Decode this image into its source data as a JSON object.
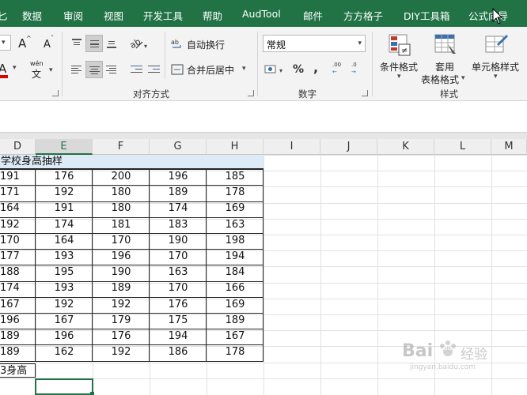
{
  "menubar": {
    "tabs": [
      "匕",
      "数据",
      "审阅",
      "视图",
      "开发工具",
      "帮助",
      "AudTool",
      "邮件",
      "方方格子",
      "DIY工具箱",
      "公式向导"
    ]
  },
  "ribbon": {
    "font_group": {
      "underline_glyph": "A",
      "wen_label": "wén",
      "wen_char": "文"
    },
    "align_group": {
      "wrap_text": "自动换行",
      "merge_center": "合并后居中",
      "label": "对齐方式"
    },
    "number_group": {
      "format_value": "常规",
      "label": "数字",
      "percent": "%",
      "comma": ",",
      "inc_decimal": ".00",
      "dec_decimal": ".0"
    },
    "style_group": {
      "conditional": "条件格式",
      "table_fmt_1": "套用",
      "table_fmt_2": "表格格式",
      "cell_style": "单元格样式",
      "label": "样式"
    }
  },
  "sheet": {
    "columns": [
      "D",
      "E",
      "F",
      "G",
      "H",
      "I",
      "J",
      "K",
      "L",
      "M"
    ],
    "active_column": "E",
    "title": "学校身高抽样",
    "rows": [
      [
        "191",
        "176",
        "200",
        "196",
        "185"
      ],
      [
        "171",
        "192",
        "180",
        "189",
        "178"
      ],
      [
        "164",
        "191",
        "180",
        "174",
        "169"
      ],
      [
        "192",
        "174",
        "181",
        "183",
        "163"
      ],
      [
        "170",
        "164",
        "170",
        "190",
        "198"
      ],
      [
        "177",
        "193",
        "196",
        "170",
        "194"
      ],
      [
        "188",
        "195",
        "190",
        "163",
        "184"
      ],
      [
        "174",
        "193",
        "189",
        "170",
        "166"
      ],
      [
        "167",
        "192",
        "192",
        "176",
        "169"
      ],
      [
        "196",
        "167",
        "179",
        "175",
        "189"
      ],
      [
        "189",
        "196",
        "176",
        "194",
        "167"
      ],
      [
        "189",
        "162",
        "192",
        "186",
        "178"
      ]
    ],
    "label_cell": "3身高"
  },
  "watermark": {
    "brand": "Bai",
    "paw": "du",
    "suffix": "经验",
    "sub": "jingyan.baidu.com"
  },
  "colors": {
    "accent": "#217346",
    "title_fill": "#ddebf7"
  }
}
